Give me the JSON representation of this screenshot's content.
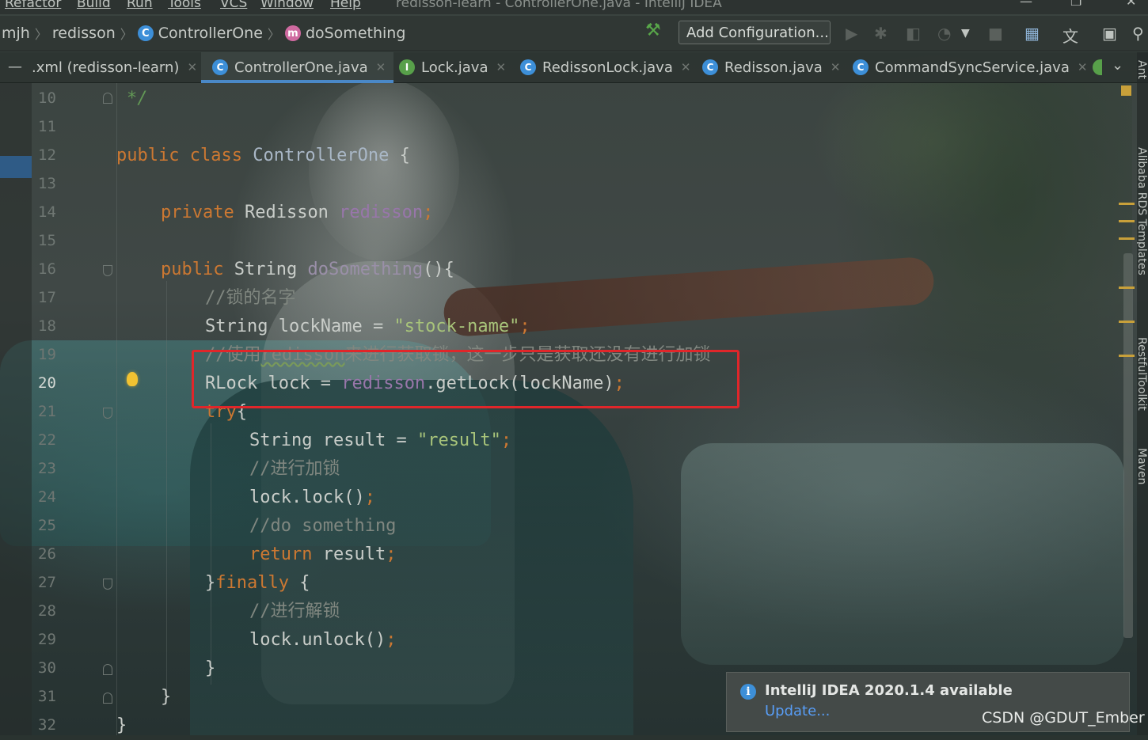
{
  "menu": {
    "items": [
      "Refactor",
      "Build",
      "Run",
      "Tools",
      "VCS",
      "Window",
      "Help"
    ],
    "window_title": "redisson-learn - ControllerOne.java - IntelliJ IDEA"
  },
  "breadcrumb": {
    "items": [
      "mjh",
      "redisson",
      "ControllerOne",
      "doSomething"
    ]
  },
  "toolbar": {
    "add_configuration": "Add Configuration..."
  },
  "tabs": [
    {
      "label": ".xml (redisson-learn)",
      "icon": "none"
    },
    {
      "label": "ControllerOne.java",
      "icon": "C",
      "active": true
    },
    {
      "label": "Lock.java",
      "icon": "I"
    },
    {
      "label": "RedissonLock.java",
      "icon": "C"
    },
    {
      "label": "Redisson.java",
      "icon": "C"
    },
    {
      "label": "CommandSyncService.java",
      "icon": "C"
    }
  ],
  "gutter": {
    "line_numbers": [
      "10",
      "11",
      "12",
      "13",
      "14",
      "15",
      "16",
      "17",
      "18",
      "19",
      "20",
      "21",
      "22",
      "23",
      "24",
      "25",
      "26",
      "27",
      "28",
      "29",
      "30",
      "31",
      "32"
    ],
    "current_line": "20"
  },
  "code": {
    "l10": "*/",
    "l12_kw": "public class",
    "l12_name": "ControllerOne",
    "l12_brace": "{",
    "l14_kw": "private",
    "l14_type": "Redisson",
    "l14_field": "redisson",
    "l14_semi": ";",
    "l16_kw": "public",
    "l16_type": "String",
    "l16_method": "doSomething",
    "l16_rest": "(){",
    "l17": "//锁的名字",
    "l18_type": "String",
    "l18_var": "lockName =",
    "l18_str": "\"stock-name\"",
    "l18_semi": ";",
    "l19_a": "//使用",
    "l19_b": "redisson",
    "l19_c": "来进行获取锁，这一步只是获取还没有进行加锁",
    "l20_type": "RLock",
    "l20_var": "lock =",
    "l20_field": "redisson",
    "l20_call": ".getLock(lockName)",
    "l20_semi": ";",
    "l21_kw": "try",
    "l21_brace": "{",
    "l22_type": "String",
    "l22_var": "result =",
    "l22_str": "\"result\"",
    "l22_semi": ";",
    "l23": "//进行加锁",
    "l24": "lock.lock()",
    "l24_semi": ";",
    "l25": "//do something",
    "l26_kw": "return",
    "l26_var": "result",
    "l26_semi": ";",
    "l27_brace": "}",
    "l27_kw": "finally",
    "l27_open": "{",
    "l28": "//进行解锁",
    "l29": "lock.unlock()",
    "l29_semi": ";",
    "l30": "}",
    "l31": "}",
    "l32": "}"
  },
  "right_panels": [
    "Ant",
    "Alibaba RDS Templates",
    "RestfulToolkit",
    "Maven"
  ],
  "notification": {
    "title": "IntelliJ IDEA 2020.1.4 available",
    "link": "Update..."
  },
  "watermark": "CSDN @GDUT_Ember",
  "colors": {
    "keyword": "#cc7832",
    "string": "#a8c47a",
    "field": "#9876aa",
    "highlight_box": "#e0262a",
    "active_tab_underline": "#4a88c7"
  }
}
